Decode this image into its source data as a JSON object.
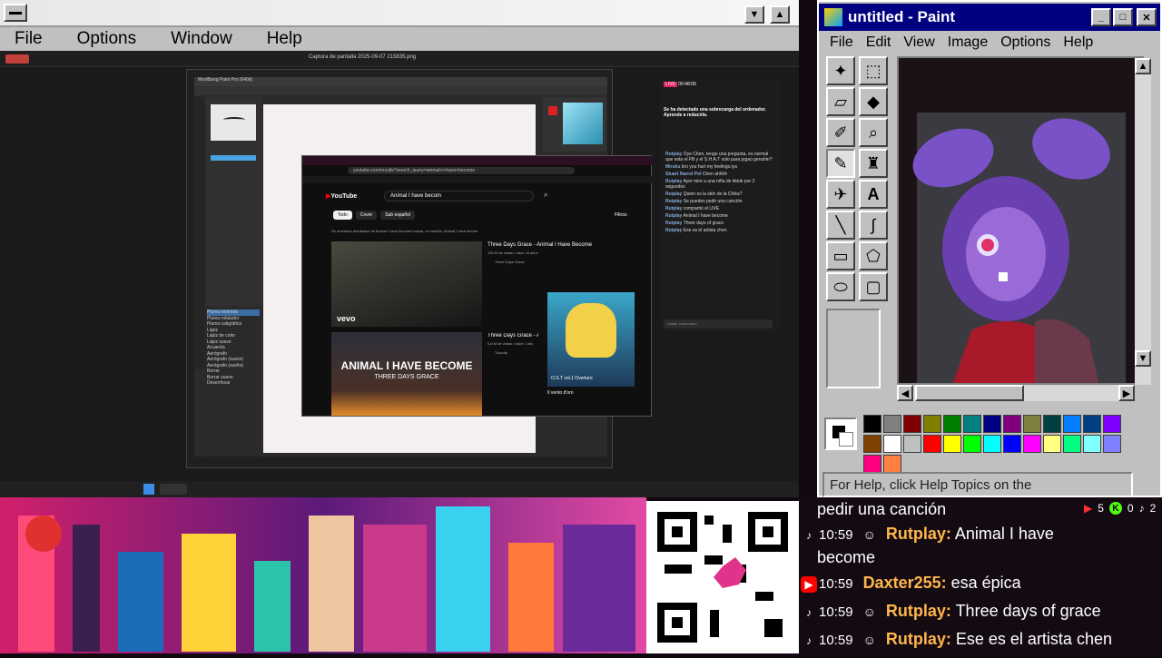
{
  "left_app": {
    "menu": [
      "File",
      "Options",
      "Window",
      "Help"
    ],
    "capture_title": "Captura de pantalla 2025-09-07 215835.png",
    "paintnet_title": "MediBang Paint Pro (64bit)",
    "brush_list": [
      "Pluma redonda",
      "Pluma rotulador",
      "Pluma caligráfica",
      "Lápiz",
      "Lápiz de color",
      "Lápiz suave",
      "Acuarela",
      "Aerógrafo",
      "Aerógrafo (suave)",
      "Aerógrafo (suelto)",
      "Borrar",
      "Borrar suave",
      "Desenfocar"
    ],
    "chat_panel": {
      "timer": "00:48:09",
      "notice": "Se ha detectado una sobrecarga del ordenador. Aprende a reducirla.",
      "messages": [
        {
          "user": "Rutplay",
          "text": "Oye Chen, tengo una pregunta, es normal que esta el FB y el S.H.A.T solo para jugaú genshin?"
        },
        {
          "user": "Miruku",
          "text": "bro you hurt my feelings.lya"
        },
        {
          "user": "Stuart Narrel Pol",
          "text": "Chen ahhhh"
        },
        {
          "user": "Rutplay",
          "text": "Ayer mire a una niña de tiktok por 2 segundos"
        },
        {
          "user": "Rutplay",
          "text": "Quien es la skin de la Chika?"
        },
        {
          "user": "Rutplay",
          "text": "Se puedes pedir una canción"
        },
        {
          "user": "Rutplay",
          "text": "compartió el LIVE"
        },
        {
          "user": "Rutplay",
          "text": "Animal I have become"
        },
        {
          "user": "Rutplay",
          "text": "Three days of grace"
        },
        {
          "user": "Rutplay",
          "text": "Ese es el artista chen"
        }
      ],
      "input_placeholder": "Añadir comentario"
    },
    "youtube": {
      "url": "youtube.com/results?search_query=animal+i+have+become",
      "search_value": "Animal I have becom",
      "chips": [
        "Todo",
        "Cover",
        "Sub español"
      ],
      "filters_label": "Filtros",
      "results_note": "Se muestran resultados de Animal I have become  buscar, en cambio, Animal I have becom",
      "videos": [
        {
          "title": "Three Days Grace - Animal I Have Become",
          "meta": "192 M de vistas • hace 18 años",
          "channel": "Three Days Grace"
        },
        {
          "title": "Three Days Grace - Animal I Have Become (Lyrics)",
          "meta": "6,8 M de vistas • hace 1 año",
          "channel": "7clouds"
        }
      ],
      "thumb2_line1": "ANIMAL I HAVE BECOME",
      "thumb2_line2": "THREE DAYS GRACE",
      "side_card": "Il vento d'oro",
      "side_card_caption": "O.S.T vol.1 Overture"
    }
  },
  "paint": {
    "title": "untitled - Paint",
    "menu": [
      "File",
      "Edit",
      "View",
      "Image",
      "Options",
      "Help"
    ],
    "status": "For Help, click Help Topics on the",
    "palette": [
      "#000000",
      "#808080",
      "#800000",
      "#808000",
      "#008000",
      "#008080",
      "#000080",
      "#800080",
      "#808040",
      "#004040",
      "#0080ff",
      "#004080",
      "#8000ff",
      "#804000",
      "#ffffff",
      "#c0c0c0",
      "#ff0000",
      "#ffff00",
      "#00ff00",
      "#00ffff",
      "#0000ff",
      "#ff00ff",
      "#ffff80",
      "#00ff80",
      "#80ffff",
      "#8080ff",
      "#ff0080",
      "#ff8040"
    ]
  },
  "stream_chat": {
    "header_fragment": "pedir una canción",
    "counts": {
      "youtube": "5",
      "kick": "0",
      "tiktok": "2"
    },
    "lines": [
      {
        "platform": "tiktok",
        "time": "10:59",
        "user": "Rutplay:",
        "text": "Animal I have",
        "wrap": "become"
      },
      {
        "platform": "youtube",
        "time": "10:59",
        "user": "Daxter255:",
        "text": "esa épica"
      },
      {
        "platform": "tiktok",
        "time": "10:59",
        "user": "Rutplay:",
        "text": "Three days of grace"
      },
      {
        "platform": "tiktok",
        "time": "10:59",
        "user": "Rutplay:",
        "text": "Ese es el artista chen"
      }
    ]
  }
}
